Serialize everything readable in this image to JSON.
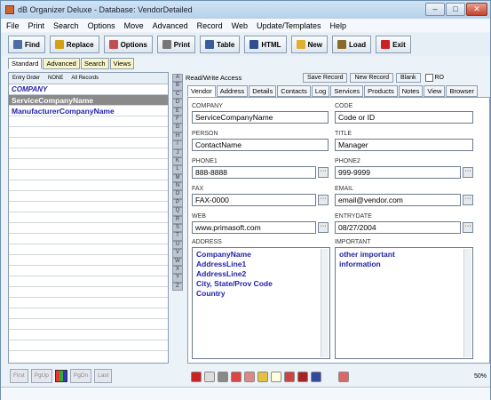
{
  "window": {
    "title": "dB Organizer Deluxe - Database: VendorDetailed"
  },
  "menu": [
    "File",
    "Print",
    "Search",
    "Options",
    "Move",
    "Advanced",
    "Record",
    "Web",
    "Update/Templates",
    "Help"
  ],
  "toolbar": {
    "find": "Find",
    "replace": "Replace",
    "options": "Options",
    "print": "Print",
    "table": "Table",
    "html": "HTML",
    "new": "New",
    "load": "Load",
    "exit": "Exit"
  },
  "subtabs": [
    "Standard",
    "Advanced",
    "Search",
    "Views"
  ],
  "left": {
    "sort_entry": "Entry Order",
    "sort_none": "NONE",
    "sort_all": "All Records",
    "column": "COMPANY",
    "rows": [
      "ServiceCompanyName",
      "ManufacturerCompanyName"
    ]
  },
  "nav": {
    "first": "First",
    "pgup": "PgUp",
    "pgdn": "PgDn",
    "last": "Last"
  },
  "letters": [
    "A",
    "B",
    "C",
    "D",
    "E",
    "F",
    "G",
    "H",
    "I",
    "J",
    "K",
    "L",
    "M",
    "N",
    "O",
    "P",
    "Q",
    "R",
    "S",
    "T",
    "U",
    "V",
    "W",
    "X",
    "Y",
    "Z"
  ],
  "record": {
    "access": "Read/Write Access",
    "save": "Save Record",
    "new": "New Record",
    "blank": "Blank",
    "ro": "RO"
  },
  "tabs": [
    "Vendor",
    "Address",
    "Details",
    "Contacts",
    "Log",
    "Services",
    "Products",
    "Notes",
    "View",
    "Browser"
  ],
  "fields": {
    "company_label": "COMPANY",
    "company": "ServiceCompanyName",
    "code_label": "CODE",
    "code": "Code or ID",
    "person_label": "PERSON",
    "person": "ContactName",
    "title_label": "TITLE",
    "title": "Manager",
    "phone1_label": "PHONE1",
    "phone1": "888-8888",
    "phone2_label": "PHONE2",
    "phone2": "999-9999",
    "fax_label": "FAX",
    "fax": "FAX-0000",
    "email_label": "EMAIL",
    "email": "email@vendor.com",
    "web_label": "WEB",
    "web": "www.primasoft.com",
    "entrydate_label": "ENTRYDATE",
    "entrydate": "08/27/2004",
    "address_label": "ADDRESS",
    "address": [
      "CompanyName",
      "AddressLine1",
      "AddressLine2",
      "City, State/Prov Code",
      "Country"
    ],
    "important_label": "IMPORTANT",
    "important": [
      "other important",
      "information"
    ]
  },
  "status": {
    "zoom": "50%"
  }
}
